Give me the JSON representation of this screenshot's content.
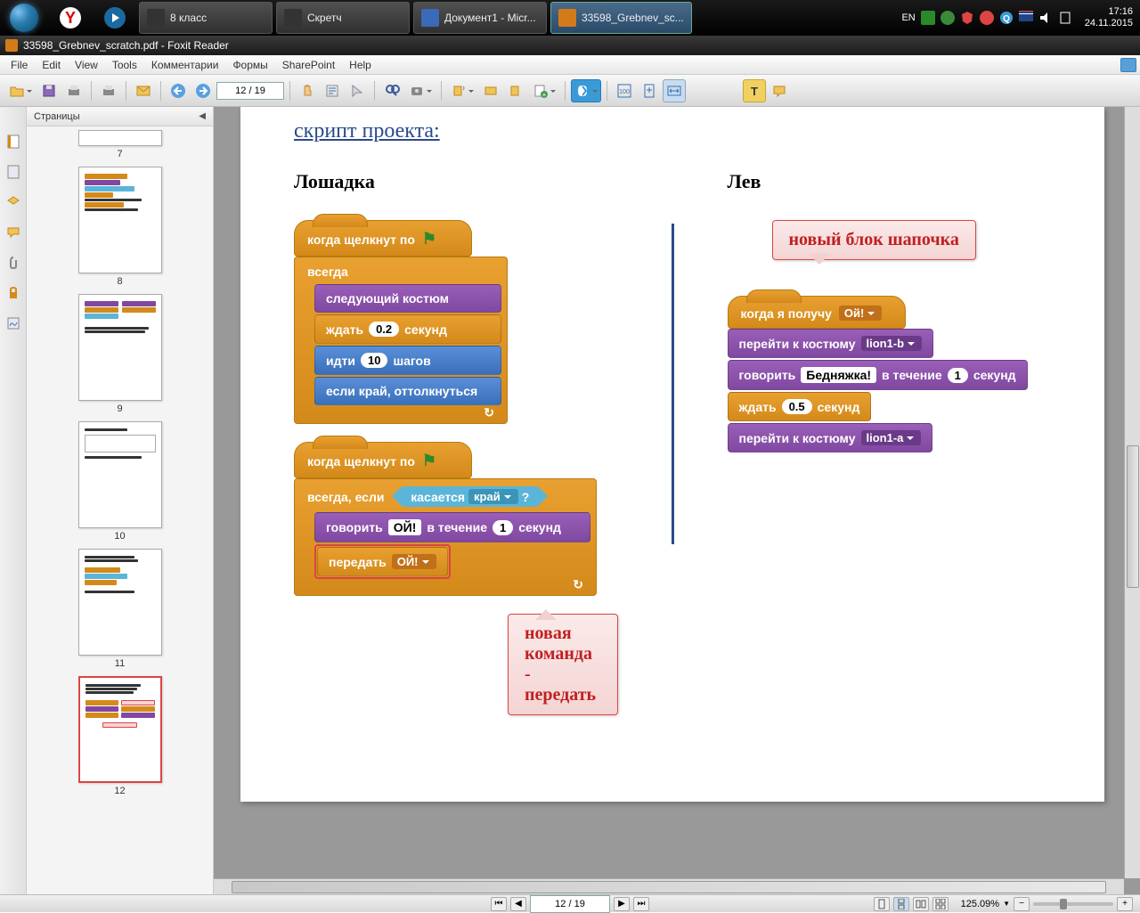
{
  "taskbar": {
    "items": [
      {
        "label": "8 класс"
      },
      {
        "label": "Скретч"
      },
      {
        "label": "Документ1 - Micr..."
      },
      {
        "label": "33598_Grebnev_sc..."
      }
    ],
    "lang": "EN",
    "time": "17:16",
    "date": "24.11.2015"
  },
  "window_title": "33598_Grebnev_scratch.pdf - Foxit Reader",
  "menu": {
    "file": "File",
    "edit": "Edit",
    "view": "View",
    "tools": "Tools",
    "comments": "Комментарии",
    "forms": "Формы",
    "sharepoint": "SharePoint",
    "help": "Help"
  },
  "toolbar": {
    "page_field": "12 / 19"
  },
  "pages_panel": {
    "title": "Страницы",
    "thumb_labels": [
      "7",
      "8",
      "9",
      "10",
      "11",
      "12"
    ]
  },
  "doc": {
    "heading": "скрипт проекта:",
    "col_left_title": "Лошадка",
    "col_right_title": "Лев",
    "callout_top": "новый блок шапочка",
    "callout_bot": "новая команда - передать",
    "left_script1": {
      "hat": "когда щелкнут по",
      "loop": "всегда",
      "b1": "следующий костюм",
      "b2_a": "ждать",
      "b2_v": "0.2",
      "b2_b": "секунд",
      "b3_a": "идти",
      "b3_v": "10",
      "b3_b": "шагов",
      "b4": "если край, оттолкнуться"
    },
    "left_script2": {
      "hat": "когда щелкнут по",
      "loop": "всегда, если",
      "touch": "касается",
      "edge": "край",
      "q": "?",
      "b1_a": "говорить",
      "b1_v": "ОЙ!",
      "b1_b": "в течение",
      "b1_n": "1",
      "b1_c": "секунд",
      "b2_a": "передать",
      "b2_v": "ОЙ!"
    },
    "right_script": {
      "hat": "когда я получу",
      "hat_v": "Ой!",
      "b1_a": "перейти к костюму",
      "b1_v": "lion1-b",
      "b2_a": "говорить",
      "b2_v": "Бедняжка!",
      "b2_b": "в течение",
      "b2_n": "1",
      "b2_c": "секунд",
      "b3_a": "ждать",
      "b3_v": "0.5",
      "b3_b": "секунд",
      "b4_a": "перейти к костюму",
      "b4_v": "lion1-a"
    }
  },
  "status": {
    "page_field": "12 / 19",
    "zoom": "125.09%"
  }
}
